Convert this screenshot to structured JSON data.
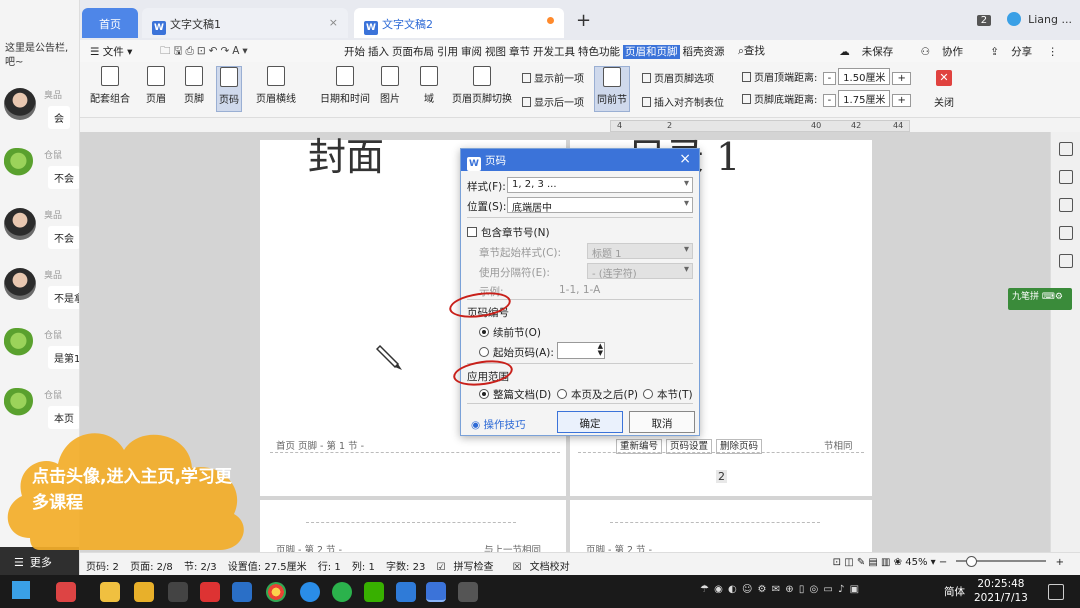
{
  "chat": {
    "notice": "这里是公告栏,吧~",
    "messages": [
      {
        "name": "臭品",
        "text": "会"
      },
      {
        "name": "仓鼠",
        "text": "不会"
      },
      {
        "name": "臭品",
        "text": "不会"
      },
      {
        "name": "臭品",
        "text": "不是拿"
      },
      {
        "name": "仓鼠",
        "text": "是第1"
      },
      {
        "name": "仓鼠",
        "text": "本页"
      }
    ],
    "more_label": "更多"
  },
  "tabs": {
    "home": "首页",
    "doc1": "文字文稿1",
    "doc2": "文字文稿2",
    "count": "2",
    "user": "Liang ..."
  },
  "menu": {
    "file": "文件",
    "items": [
      "开始",
      "插入",
      "页面布局",
      "引用",
      "审阅",
      "视图",
      "章节",
      "开发工具",
      "特色功能",
      "页眉和页脚",
      "稻壳资源"
    ],
    "active": "页眉和页脚",
    "search": "查找",
    "unsaved": "未保存",
    "collab": "协作",
    "share": "分享"
  },
  "ribbon": {
    "buttons": [
      "配套组合",
      "页眉",
      "页脚",
      "页码",
      "页眉横线",
      "日期和时间",
      "图片",
      "域",
      "页眉页脚切换"
    ],
    "show_prev": "显示前一项",
    "show_next": "显示后一项",
    "same_as_prev": "同前节",
    "hf_options": "页眉页脚选项",
    "insert_align_tab": "插入对齐制表位",
    "header_top_label": "页眉顶端距离:",
    "header_top_value": "1.50厘米",
    "footer_bottom_label": "页脚底端距离:",
    "footer_bottom_value": "1.75厘米",
    "close": "关闭"
  },
  "ruler": {
    "marks": [
      "4",
      "2",
      "40",
      "42",
      "44"
    ]
  },
  "document": {
    "title_left": "封面",
    "title_right": "目录 1",
    "footer1": "首页 页脚 - 第 1 节 -",
    "footer_tools": [
      "重新编号",
      "页码设置",
      "删除页码"
    ],
    "footer_right_label": "节相同",
    "page_number": "2",
    "footer2_left": "页脚 - 第 2 节 -",
    "footer2_left_tail": "与上一节相同",
    "footer2_right": "页脚 - 第 2 节 -"
  },
  "dialog": {
    "title": "页码",
    "style_label": "样式(F):",
    "style_value": "1, 2, 3 ...",
    "position_label": "位置(S):",
    "position_value": "底端居中",
    "include_chapter": "包含章节号(N)",
    "chapter_start_label": "章节起始样式(C):",
    "chapter_start_value": "标题 1",
    "separator_label": "使用分隔符(E):",
    "separator_value": "- (连字符)",
    "example_label": "示例:",
    "example_value": "1-1, 1-A",
    "numbering_section": "页码编号",
    "continue_prev": "续前节(O)",
    "start_at": "起始页码(A):",
    "apply_section": "应用范围",
    "whole_doc": "整篇文档(D)",
    "this_and_after": "本页及之后(P)",
    "this_section": "本节(T)",
    "tips": "操作技巧",
    "ok": "确定",
    "cancel": "取消"
  },
  "side_badge": "九笔拼",
  "status": {
    "page_num": "页码: 2",
    "page": "页面: 2/8",
    "section": "节: 2/3",
    "setting": "设置值: 27.5厘米",
    "row": "行: 1",
    "col": "列: 1",
    "words": "字数: 23",
    "spell": "拼写检查",
    "proof": "文档校对",
    "zoom": "45%"
  },
  "overlay": {
    "text": "点击头像,进入主页,学习更多课程"
  },
  "taskbar": {
    "lang": "简体",
    "time": "20:25:48",
    "date": "2021/7/13"
  }
}
